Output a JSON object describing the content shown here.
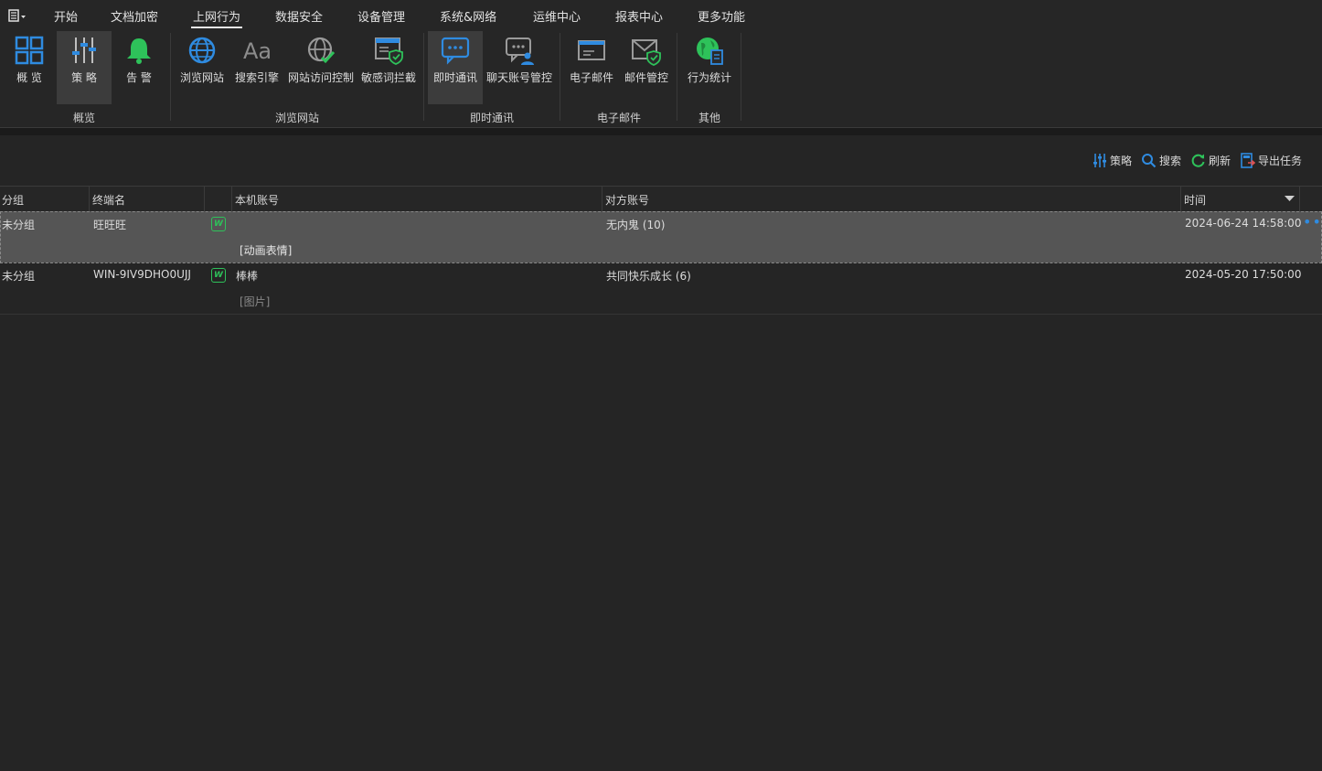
{
  "menubar": {
    "items": [
      "开始",
      "文档加密",
      "上网行为",
      "数据安全",
      "设备管理",
      "系统&网络",
      "运维中心",
      "报表中心",
      "更多功能"
    ],
    "active_index": 2
  },
  "ribbon": {
    "buttons": [
      {
        "label": "概 览",
        "icon": "dashboard-grid-icon"
      },
      {
        "label": "策 略",
        "icon": "sliders-icon",
        "selected": true
      },
      {
        "label": "告 警",
        "icon": "bell-icon"
      },
      {
        "label": "浏览网站",
        "icon": "globe-icon"
      },
      {
        "label": "搜索引擎",
        "icon": "font-aa-icon"
      },
      {
        "label": "网站访问控制",
        "icon": "globe-check-icon"
      },
      {
        "label": "敏感词拦截",
        "icon": "window-shield-icon"
      },
      {
        "label": "即时通讯",
        "icon": "chat-bubble-icon",
        "selected": true
      },
      {
        "label": "聊天账号管控",
        "icon": "chat-user-icon"
      },
      {
        "label": "电子邮件",
        "icon": "envelope-icon"
      },
      {
        "label": "邮件管控",
        "icon": "envelope-shield-icon"
      },
      {
        "label": "行为统计",
        "icon": "globe-report-icon"
      }
    ],
    "groups": [
      "概览",
      "浏览网站",
      "即时通讯",
      "电子邮件",
      "其他"
    ]
  },
  "toolbar": {
    "policy": "策略",
    "search": "搜索",
    "refresh": "刷新",
    "export": "导出任务"
  },
  "table": {
    "headers": {
      "group": "分组",
      "terminal": "终端名",
      "local_account": "本机账号",
      "peer_account": "对方账号",
      "time": "时间"
    },
    "rows": [
      {
        "group": "未分组",
        "terminal": "旺旺旺",
        "app_icon": "W",
        "local_account": "",
        "content": "[动画表情]",
        "peer_account": "无内鬼 (10)",
        "time": "2024-06-24 14:58:00",
        "selected": true
      },
      {
        "group": "未分组",
        "terminal": "WIN-9IV9DHO0UJJ",
        "app_icon": "W",
        "local_account": "棒棒",
        "content": "[图片]",
        "peer_account": "共同快乐成长 (6)",
        "time": "2024-05-20 17:50:00",
        "selected": false
      }
    ],
    "more": "•••"
  },
  "colors": {
    "accent_blue": "#2f8be0",
    "green": "#2ec25a",
    "bg": "#252525",
    "selected_row": "#555555"
  }
}
